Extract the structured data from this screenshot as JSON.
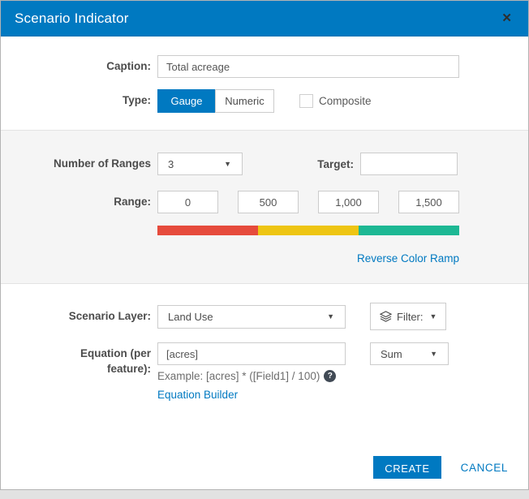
{
  "dialog": {
    "title": "Scenario Indicator"
  },
  "icons": {
    "close": "✕",
    "caret": "▼",
    "help": "?"
  },
  "caption": {
    "label": "Caption:",
    "value": "Total acreage"
  },
  "type": {
    "label": "Type:",
    "options": [
      {
        "label": "Gauge",
        "selected": true
      },
      {
        "label": "Numeric",
        "selected": false
      }
    ],
    "composite_label": "Composite",
    "composite_checked": false
  },
  "ranges": {
    "number_label": "Number of Ranges",
    "number_value": "3",
    "target_label": "Target:",
    "target_value": "",
    "range_label": "Range:",
    "range_values": [
      "0",
      "500",
      "1,000",
      "1,500"
    ],
    "ramp_colors": [
      "#e64b3c",
      "#eec513",
      "#1db894"
    ],
    "reverse_link": "Reverse Color Ramp"
  },
  "layer": {
    "label": "Scenario Layer:",
    "value": "Land Use",
    "filter_label": "Filter:"
  },
  "equation": {
    "label": "Equation (per feature):",
    "value": "[acres]",
    "aggregation": "Sum",
    "example": "Example: [acres] * ([Field1] / 100)",
    "builder_link": "Equation Builder"
  },
  "footer": {
    "create_label": "CREATE",
    "cancel_label": "CANCEL"
  },
  "colors": {
    "accent": "#0079c1",
    "ramp_red": "#e64b3c",
    "ramp_yellow": "#eec513",
    "ramp_green": "#1db894"
  }
}
